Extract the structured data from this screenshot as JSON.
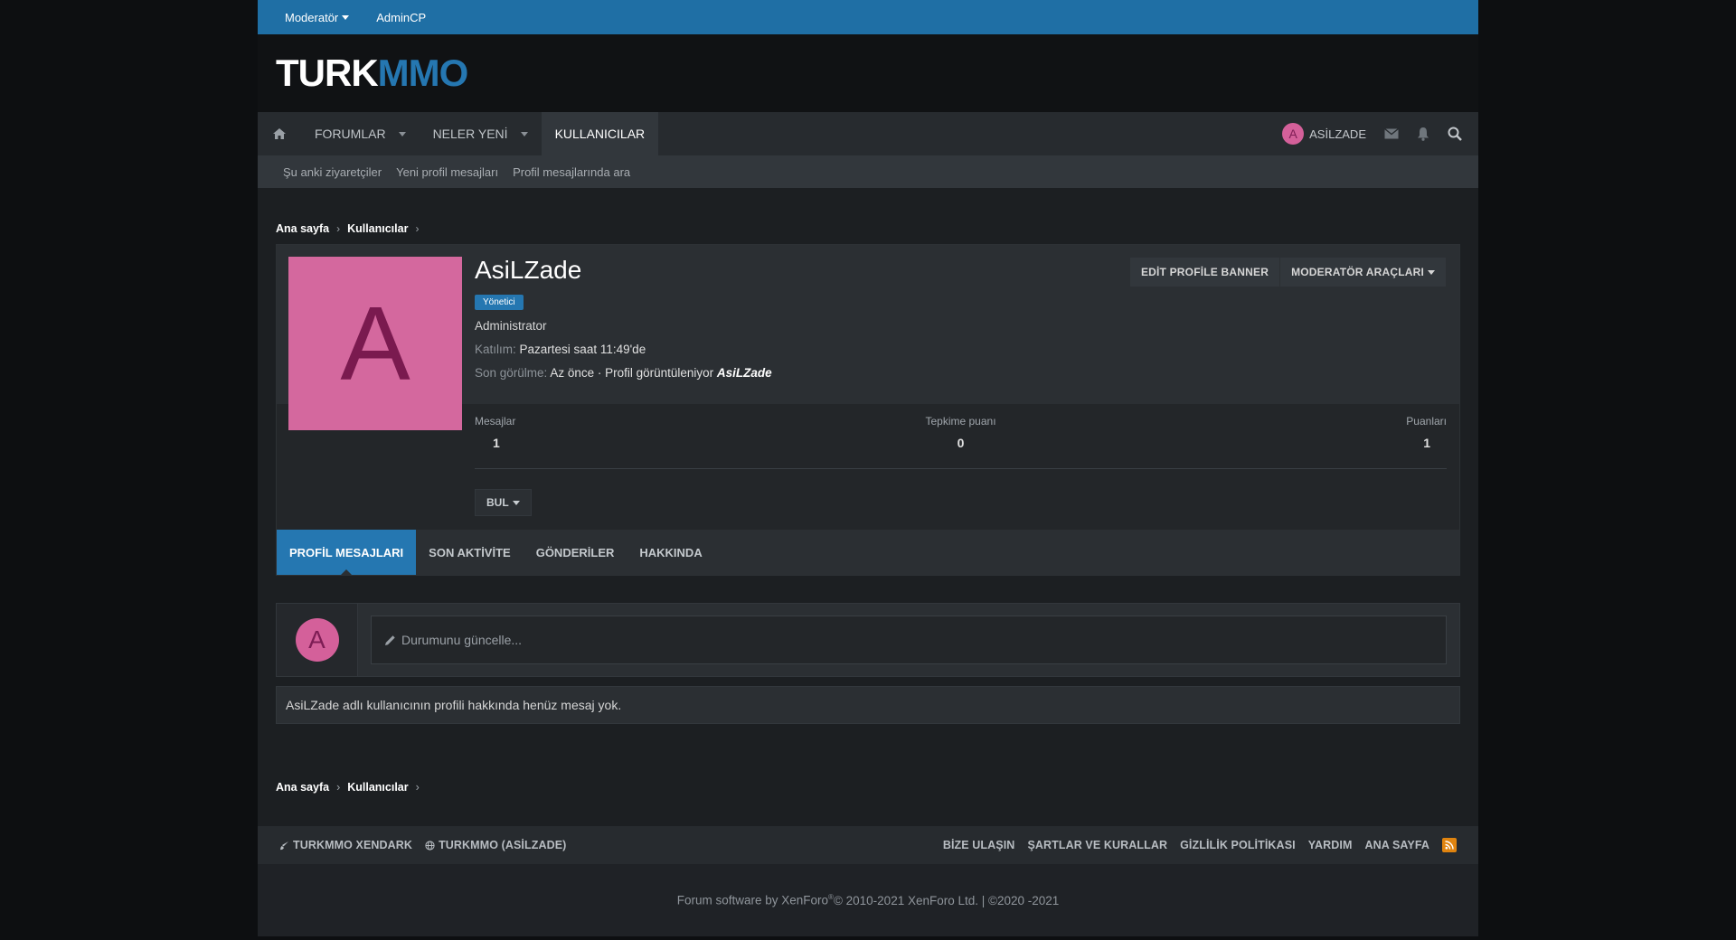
{
  "staffbar": {
    "moderator": "Moderatör",
    "admincp": "AdminCP"
  },
  "logo": {
    "part1": "TURK",
    "part2": "MMO"
  },
  "nav": {
    "tabs": [
      "FORUMLAR",
      "NELER YENİ",
      "KULLANICILAR"
    ],
    "username": "ASİLZADE",
    "avatar_letter": "A"
  },
  "subnav": [
    "Şu anki ziyaretçiler",
    "Yeni profil mesajları",
    "Profil mesajlarında ara"
  ],
  "breadcrumb": [
    "Ana sayfa",
    "Kullanıcılar"
  ],
  "profile": {
    "avatar_letter": "A",
    "name": "AsiLZade",
    "badge": "Yönetici",
    "title": "Administrator",
    "joined_label": "Katılım:",
    "joined_value": "Pazartesi saat 11:49'de",
    "lastseen_label": "Son görülme:",
    "lastseen_value": "Az önce · Profil görüntüleniyor",
    "lastseen_user": "AsiLZade",
    "btn_banner": "EDİT PROFİLE BANNER",
    "btn_tools": "MODERATÖR ARAÇLARI",
    "stats": [
      {
        "label": "Mesajlar",
        "value": "1"
      },
      {
        "label": "Tepkime puanı",
        "value": "0"
      },
      {
        "label": "Puanları",
        "value": "1"
      }
    ],
    "find": "BUL",
    "tabs": [
      "PROFİL MESAJLARI",
      "SON AKTİVİTE",
      "GÖNDERİLER",
      "HAKKINDA"
    ]
  },
  "status": {
    "avatar_letter": "A",
    "placeholder": "Durumunu güncelle..."
  },
  "empty_message": "AsiLZade adlı kullanıcının profili hakkında henüz mesaj yok.",
  "footer": {
    "left": [
      "TURKMMO XENDARK",
      "TURKMMO (ASİLZADE)"
    ],
    "right": [
      "BİZE ULAŞIN",
      "ŞARTLAR VE KURALLAR",
      "GİZLİLİK POLİTİKASI",
      "YARDIM",
      "ANA SAYFA"
    ],
    "copyright_a": "Forum software by XenForo",
    "copyright_sup": "®",
    "copyright_b": " © 2010-2021 XenForo Ltd. | ©2020 -2021"
  },
  "colors": {
    "accent": "#2577b1",
    "avatar": "#d4689e"
  }
}
